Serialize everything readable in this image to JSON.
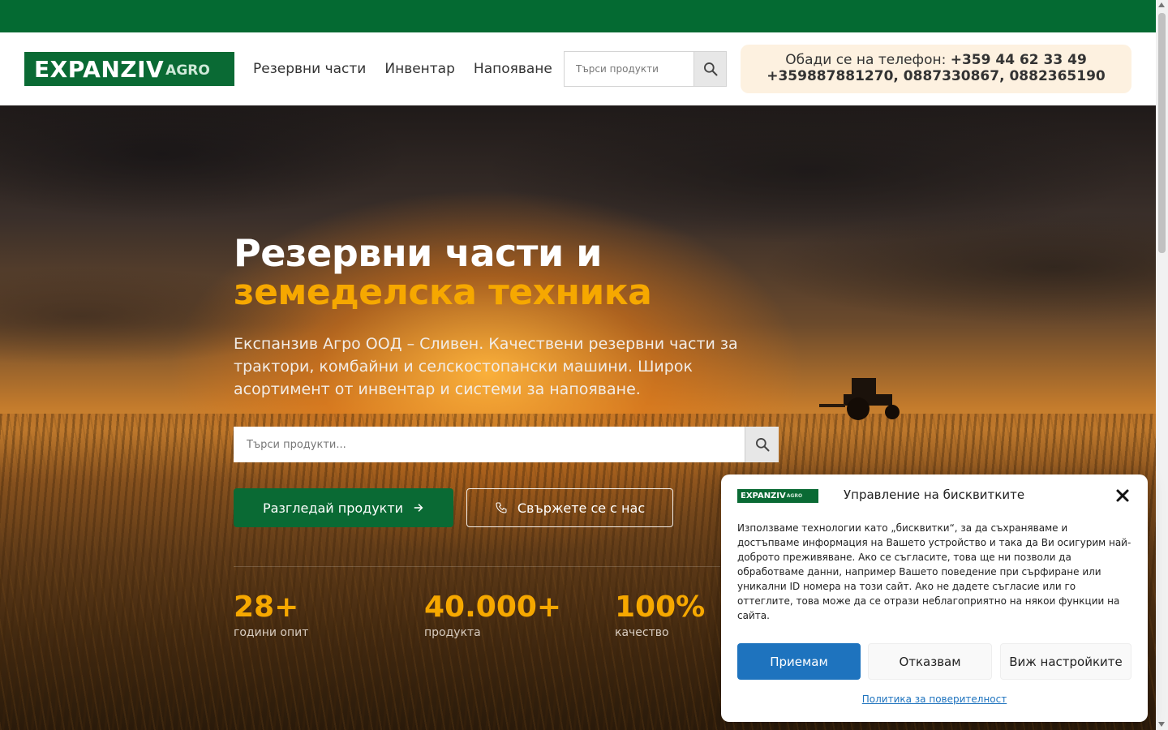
{
  "header": {
    "logo_main": "EXPANZIV",
    "logo_sub": "AGRO",
    "nav": [
      {
        "label": "Резервни части"
      },
      {
        "label": "Инвентар"
      },
      {
        "label": "Напояване"
      }
    ],
    "search_placeholder": "Търси продукти",
    "phone_prefix": "Обади се на телефон: ",
    "phone_main": "+359 44 62 33 49",
    "phone_others": "+359887881270, 0887330867, 0882365190"
  },
  "hero": {
    "title_line1": "Резервни части и",
    "title_line2": "земеделска техника",
    "lead": "Експанзив Агро ООД – Сливен. Качествени резервни части за трактори, комбайни и селскостопански машини. Широк асортимент от инвентар и системи за напояване.",
    "search_placeholder": "Търси продукти...",
    "cta_primary": "Разгледай продукти",
    "cta_secondary": "Свържете се с нас",
    "stats": [
      {
        "value": "28+",
        "label": "години опит"
      },
      {
        "value": "40.000+",
        "label": "продукта"
      },
      {
        "value": "100%",
        "label": "качество"
      }
    ]
  },
  "cookie": {
    "logo_main": "EXPANZIV",
    "logo_sub": "AGRO",
    "title": "Управление на бисквитките",
    "text": "Използваме технологии като „бисквитки“, за да съхраняваме и достъпваме информация на Вашето устройство и така да Ви осигурим най-доброто преживяване. Ако се съгласите, това ще ни позволи да обработваме данни, например Вашето поведение при сърфиране или уникални ID номера на този сайт. Ако не дадете съгласие или го оттеглите, това може да се отрази неблагоприятно на някои функции на сайта.",
    "accept": "Приемам",
    "deny": "Отказвам",
    "preferences": "Виж настройките",
    "policy_link": "Политика за поверителност"
  },
  "colors": {
    "brand_green": "#0a6a34",
    "accent_orange": "#f6a800",
    "cookie_blue": "#1e73be"
  }
}
